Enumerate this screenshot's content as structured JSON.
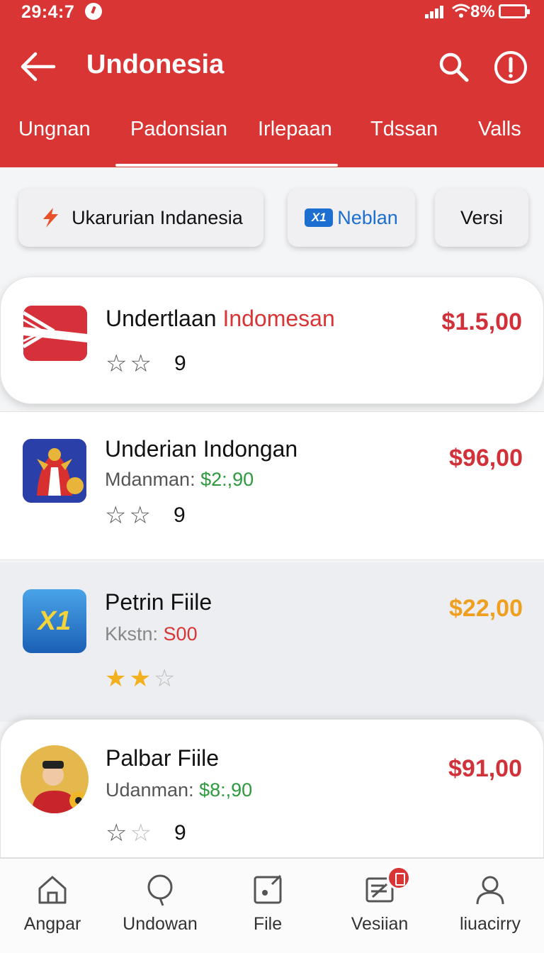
{
  "status_bar": {
    "time": "29:4:7",
    "battery": "8%"
  },
  "header": {
    "title": "Undonesia"
  },
  "tabs": [
    {
      "label": "Ungnan"
    },
    {
      "label": "Padonsian"
    },
    {
      "label": "Irlepaan"
    },
    {
      "label": "Tdssan"
    },
    {
      "label": "Valls"
    }
  ],
  "chips": [
    {
      "label": "Ukarurian Indanesia",
      "icon": "bolt-icon"
    },
    {
      "label": "Neblan",
      "badge": "X1"
    },
    {
      "label": "Versi"
    }
  ],
  "items": [
    {
      "title": "Undertlaan",
      "title_accent": "Indomesan",
      "price": "$1.5,00",
      "rating": "9"
    },
    {
      "title": "Underian Indongan",
      "sub_label": "Mdanman:",
      "sub_value": "$2:,90",
      "price": "$96,00",
      "rating": "9"
    },
    {
      "title": "Petrin Fiile",
      "sub_label": "Kkstn:",
      "sub_value": "S00",
      "price": "$22,00",
      "thumb_text": "X1",
      "stars_filled": 2
    },
    {
      "title": "Palbar Fiile",
      "sub_label": "Udanman:",
      "sub_value": "$8:,90",
      "price": "$91,00",
      "rating": "9"
    }
  ],
  "bottom_nav": [
    {
      "label": "Angpar",
      "icon": "home-icon"
    },
    {
      "label": "Undowan",
      "icon": "bubble-icon"
    },
    {
      "label": "File",
      "icon": "file-icon"
    },
    {
      "label": "Vesiian",
      "icon": "message-icon"
    },
    {
      "label": "liuacirry",
      "icon": "person-icon"
    }
  ],
  "colors": {
    "brand": "#d93535",
    "price_red": "#d1323a",
    "price_orange": "#f0a020",
    "green": "#2c9a3d",
    "star": "#f2b01e"
  }
}
